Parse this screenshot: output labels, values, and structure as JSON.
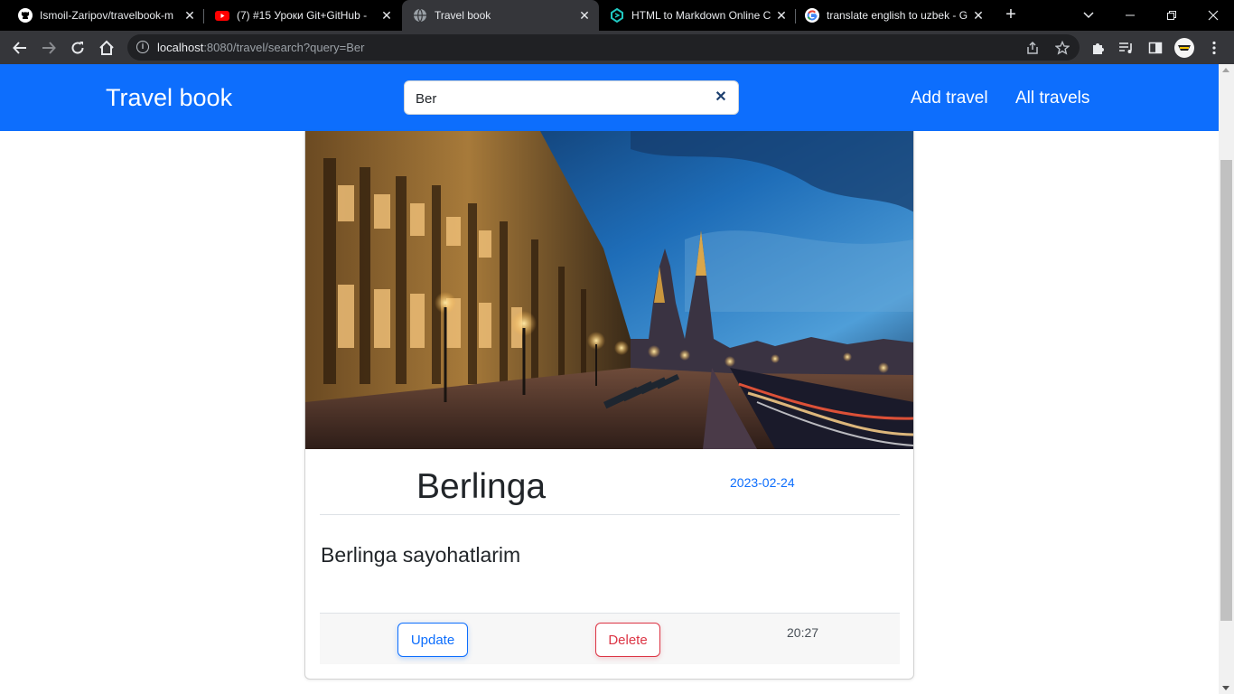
{
  "browser": {
    "tabs": [
      {
        "title": "Ismoil-Zaripov/travelbook-m",
        "icon": "github-icon"
      },
      {
        "title": "(7) #15 Уроки Git+GitHub - ",
        "icon": "youtube-icon"
      },
      {
        "title": "Travel book",
        "icon": "globe-icon"
      },
      {
        "title": "HTML to Markdown Online C",
        "icon": "codebeautify-icon"
      },
      {
        "title": "translate english to uzbek - G",
        "icon": "google-icon"
      }
    ],
    "address": {
      "host": "localhost",
      "path": ":8080/travel/search?query=Ber"
    }
  },
  "navbar": {
    "brand": "Travel book",
    "search_value": "Ber",
    "links": [
      "Add travel",
      "All travels"
    ]
  },
  "card": {
    "title": "Berlinga",
    "date": "2023-02-24",
    "description": "Berlinga sayohatlarim",
    "update_label": "Update",
    "delete_label": "Delete",
    "time": "20:27"
  },
  "colors": {
    "navbar": "#0d6efd",
    "update": "#0d6efd",
    "delete": "#dc3545"
  }
}
